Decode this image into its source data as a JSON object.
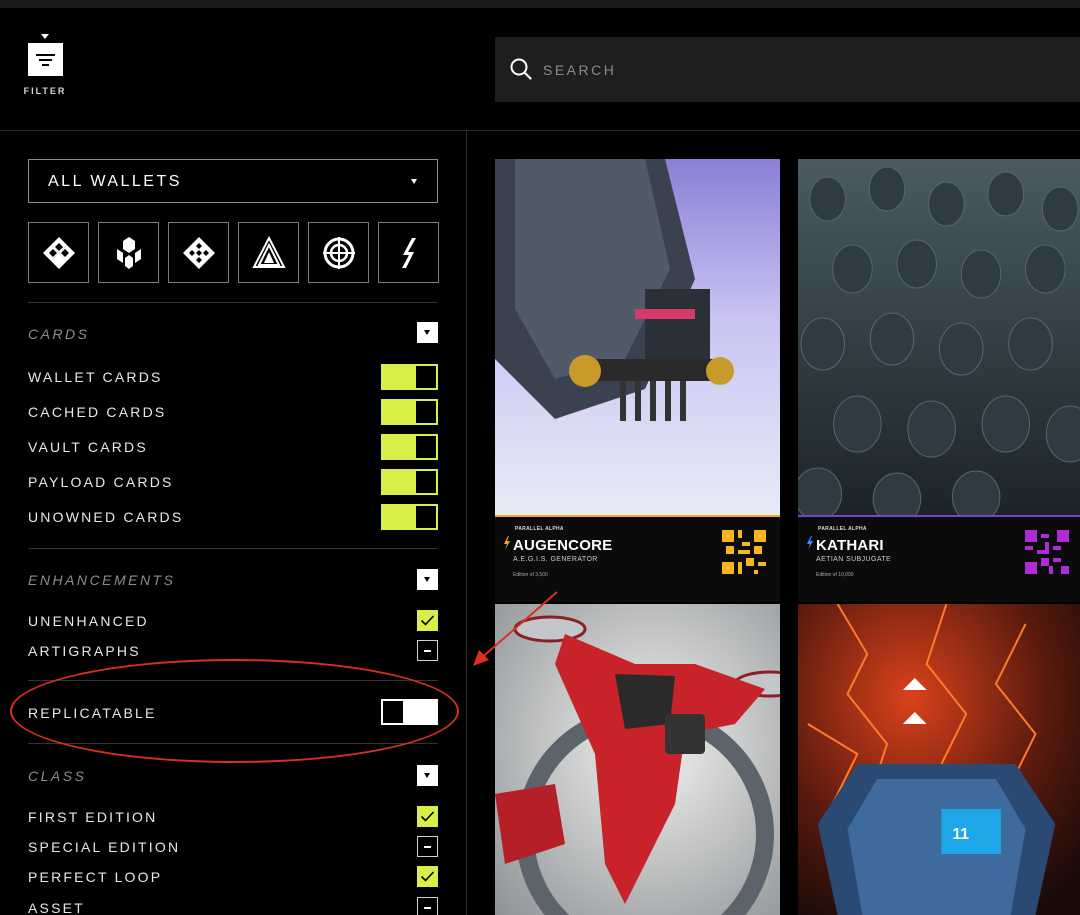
{
  "header": {
    "filter_label": "FILTER",
    "search_placeholder": "SEARCH"
  },
  "sidebar": {
    "wallet_select": "ALL WALLETS",
    "parallels": [
      "earthen-icon",
      "kathari-icon",
      "marcolian-icon",
      "augencore-icon",
      "shroud-icon",
      "universal-icon"
    ],
    "cards_section": {
      "title": "CARDS",
      "items": [
        {
          "label": "WALLET CARDS",
          "on": true
        },
        {
          "label": "CACHED CARDS",
          "on": true
        },
        {
          "label": "VAULT CARDS",
          "on": true
        },
        {
          "label": "PAYLOAD CARDS",
          "on": true
        },
        {
          "label": "UNOWNED CARDS",
          "on": true
        }
      ]
    },
    "enhancements_section": {
      "title": "ENHANCEMENTS",
      "items": [
        {
          "label": "UNENHANCED",
          "checked": true
        },
        {
          "label": "ARTIGRAPHS",
          "checked": false
        }
      ]
    },
    "replicatable": {
      "label": "REPLICATABLE",
      "on": false
    },
    "class_section": {
      "title": "CLASS",
      "items": [
        {
          "label": "FIRST EDITION",
          "checked": true
        },
        {
          "label": "SPECIAL EDITION",
          "checked": false
        },
        {
          "label": "PERFECT LOOP",
          "checked": true
        },
        {
          "label": "ASSET",
          "checked": false
        }
      ]
    }
  },
  "cards": [
    {
      "set": "PARALLEL ALPHA",
      "name": "AUGENCORE",
      "subtitle": "A.E.G.I.S. GENERATOR",
      "edition": "Edition of 3,500",
      "accent": "#f5a623",
      "qr_color": "#f5b51c"
    },
    {
      "set": "PARALLEL ALPHA",
      "name": "KATHARI",
      "subtitle": "AETIAN SUBJUGATE",
      "edition": "Edition of 10,000",
      "accent": "#3d8bff",
      "qr_color": "#b02ad8"
    },
    {
      "set": "",
      "name": "",
      "subtitle": "",
      "edition": "",
      "accent": "#d21f2a",
      "qr_color": ""
    },
    {
      "set": "",
      "name": "",
      "subtitle": "",
      "edition": "",
      "accent": "#ff4a1a",
      "qr_color": ""
    }
  ],
  "colors": {
    "accent_toggle": "#d9ee47",
    "annotation": "#d9301f",
    "panel_dark": "#1e1e1e"
  }
}
